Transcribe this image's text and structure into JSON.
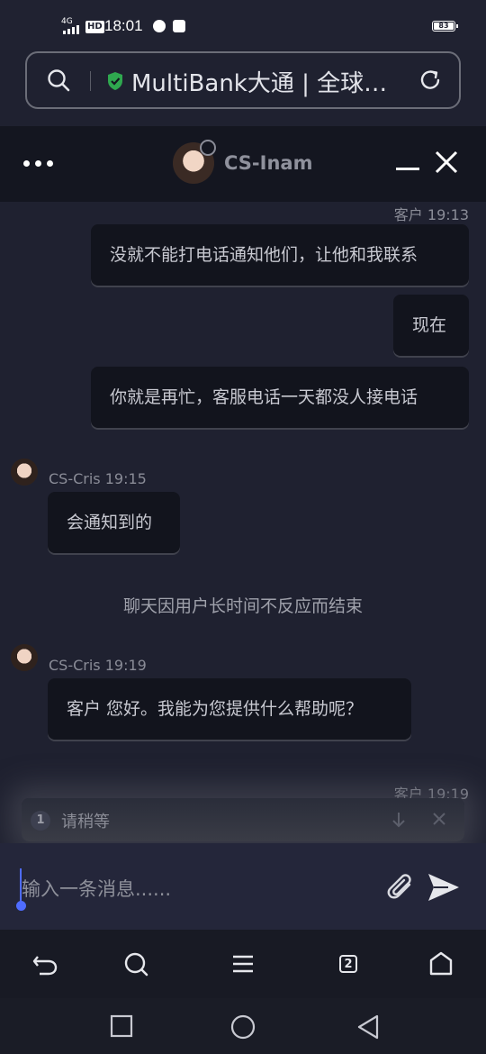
{
  "status_bar": {
    "network": "4G",
    "time": "18:01",
    "battery": "83"
  },
  "url_bar": {
    "title": "MultiBank大通 | 全球…",
    "secure_icon": "shield-check-icon"
  },
  "chat_header": {
    "agent_name": "CS-Inam",
    "menu_icon": "more-dots-icon",
    "minimize_icon": "minimize-icon",
    "close_icon": "close-icon"
  },
  "messages": {
    "customer_meta_1": "客户 19:13",
    "customer_msg_1": "没就不能打电话通知他们，让他和我联系",
    "customer_msg_2": "现在",
    "customer_msg_3": "你就是再忙，客服电话一天都没人接电话",
    "agent_meta_1": "CS-Cris 19:15",
    "agent_msg_1": "会通知到的",
    "system_note": "聊天因用户长时间不反应而结束",
    "agent_meta_2": "CS-Cris 19:19",
    "agent_msg_2": "客户 您好。我能为您提供什么帮助呢？",
    "customer_meta_2": "客户 19:19"
  },
  "waiting_banner": {
    "number": "1",
    "text": "请稍等"
  },
  "composer": {
    "placeholder": "输入一条消息......"
  },
  "browser_nav": {
    "tab_count": "2"
  }
}
